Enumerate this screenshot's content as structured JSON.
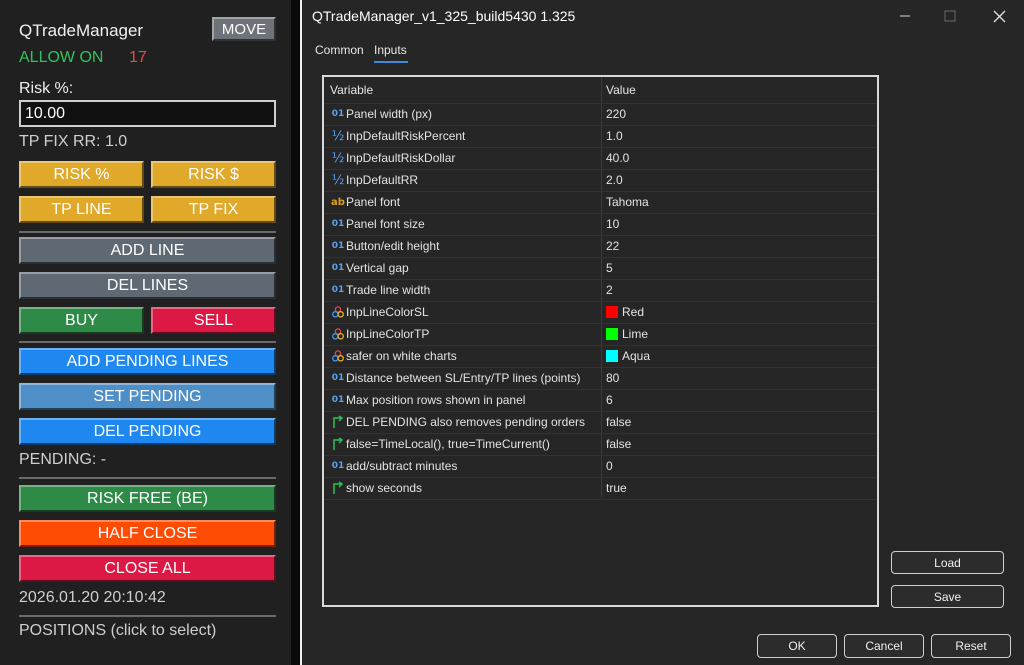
{
  "panel": {
    "title": "QTradeManager",
    "move_label": "MOVE",
    "allow_status": "ALLOW ON",
    "allow_count": "17",
    "risk_label": "Risk %:",
    "risk_value": "10.00",
    "tp_fix_rr": "TP FIX RR: 1.0",
    "buttons": {
      "risk_pct": "RISK %",
      "risk_usd": "RISK $",
      "tp_line": "TP LINE",
      "tp_fix": "TP FIX",
      "add_line": "ADD LINE",
      "del_lines": "DEL LINES",
      "buy": "BUY",
      "sell": "SELL",
      "add_pending_lines": "ADD PENDING LINES",
      "set_pending": "SET PENDING",
      "del_pending": "DEL PENDING",
      "risk_free": "RISK FREE (BE)",
      "half_close": "HALF CLOSE",
      "close_all": "CLOSE ALL"
    },
    "pending_status": "PENDING: -",
    "datetime": "2026.01.20 20:10:42",
    "positions_label": "POSITIONS (click to select)",
    "colors": {
      "background": "#202020",
      "allow_green": "#31c25a",
      "count_red": "#e84a4a",
      "gold": "#e0a92a",
      "slate": "#5f6973",
      "green": "#2e8b47",
      "crimson": "#dc1845",
      "blue": "#1e88f0",
      "steel": "#4f8fc8",
      "orange": "#ff4c05"
    }
  },
  "dialog": {
    "title": "QTradeManager_v1_325_build5430 1.325",
    "tabs": [
      "Common",
      "Inputs"
    ],
    "active_tab": "Inputs",
    "columns": {
      "variable": "Variable",
      "value": "Value"
    },
    "rows": [
      {
        "icon": "int-icon",
        "variable": "Panel width (px)",
        "value": "220"
      },
      {
        "icon": "double-icon",
        "variable": "InpDefaultRiskPercent",
        "value": "1.0"
      },
      {
        "icon": "double-icon",
        "variable": "InpDefaultRiskDollar",
        "value": "40.0"
      },
      {
        "icon": "double-icon",
        "variable": "InpDefaultRR",
        "value": "2.0"
      },
      {
        "icon": "string-icon",
        "variable": "Panel font",
        "value": "Tahoma"
      },
      {
        "icon": "int-icon",
        "variable": "Panel font size",
        "value": "10"
      },
      {
        "icon": "int-icon",
        "variable": "Button/edit height",
        "value": "22"
      },
      {
        "icon": "int-icon",
        "variable": "Vertical gap",
        "value": "5"
      },
      {
        "icon": "int-icon",
        "variable": "Trade line width",
        "value": "2"
      },
      {
        "icon": "color-icon",
        "variable": "InpLineColorSL",
        "value": "Red",
        "swatch": "#ff0000"
      },
      {
        "icon": "color-icon",
        "variable": "InpLineColorTP",
        "value": "Lime",
        "swatch": "#00ff00"
      },
      {
        "icon": "color-icon",
        "variable": "safer on white charts",
        "value": "Aqua",
        "swatch": "#00ffff"
      },
      {
        "icon": "int-icon",
        "variable": "Distance between SL/Entry/TP lines (points)",
        "value": "80"
      },
      {
        "icon": "int-icon",
        "variable": "Max position rows shown in panel",
        "value": "6"
      },
      {
        "icon": "bool-icon",
        "variable": "DEL PENDING also removes pending orders",
        "value": "false"
      },
      {
        "icon": "bool-icon",
        "variable": "false=TimeLocal(), true=TimeCurrent()",
        "value": "false"
      },
      {
        "icon": "int-icon",
        "variable": "add/subtract minutes",
        "value": "0"
      },
      {
        "icon": "bool-icon",
        "variable": "show seconds",
        "value": "true"
      }
    ],
    "buttons": {
      "load": "Load",
      "save": "Save",
      "ok": "OK",
      "cancel": "Cancel",
      "reset": "Reset"
    },
    "colors": {
      "background": "#262626",
      "tab_accent": "#3d8ad9",
      "icon_int": "#5aa2f0",
      "icon_double": "#5aa2f0",
      "icon_string": "#e0a020",
      "icon_bool": "#2fbf5a"
    }
  }
}
